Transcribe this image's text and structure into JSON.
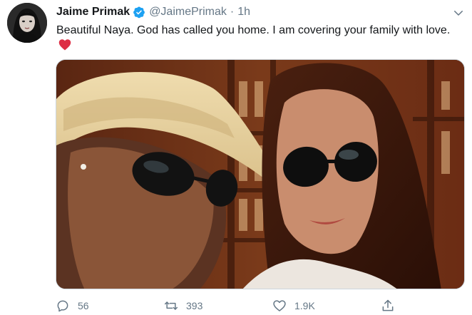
{
  "tweet": {
    "display_name": "Jaime Primak",
    "handle": "@JaimePrimak",
    "separator": "·",
    "time": "1h",
    "text": "Beautiful Naya. God has called you home. I am covering your family with love.",
    "verified": true
  },
  "icons": {
    "avatar": "profile-photo",
    "verified": "verified-badge-icon",
    "caret": "chevron-down-icon",
    "emoji": "red-heart-emoji",
    "reply": "reply-icon",
    "retweet": "retweet-icon",
    "like": "heart-icon",
    "share": "share-icon"
  },
  "actions": {
    "reply_count": "56",
    "retweet_count": "393",
    "like_count": "1.9K"
  },
  "colors": {
    "accent": "#1da1f2",
    "heart": "#e0245e",
    "muted": "#657786"
  }
}
